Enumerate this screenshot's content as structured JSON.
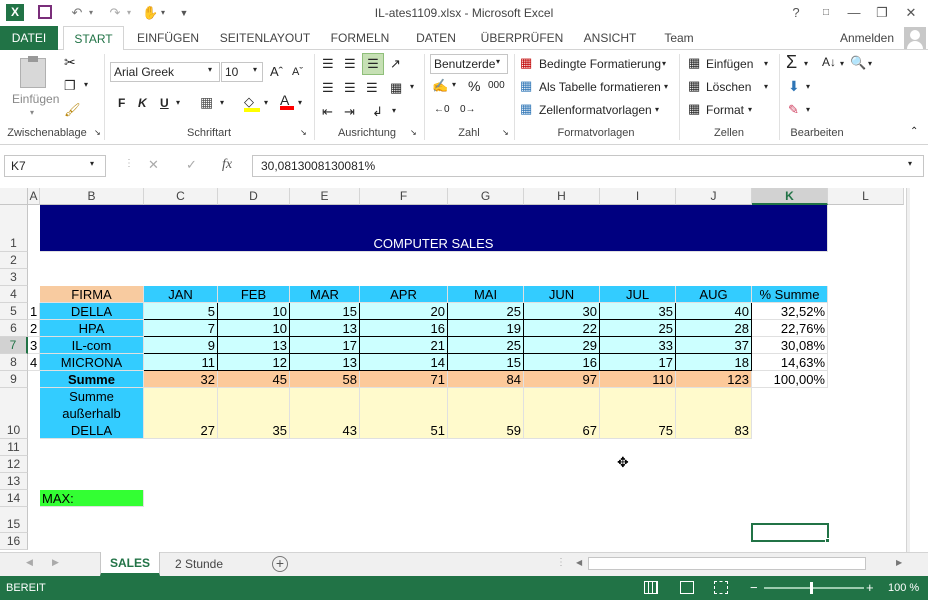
{
  "title": "IL-ates1109.xlsx - Microsoft Excel",
  "window_buttons": {
    "help": "?",
    "restore_ribbon": "□",
    "minimize": "—",
    "maximize": "❐",
    "close": "✕"
  },
  "quick_access": {
    "excel_logo": "X"
  },
  "ribbon_tabs": [
    "DATEI",
    "START",
    "EINFÜGEN",
    "SEITENLAYOUT",
    "FORMELN",
    "DATEN",
    "ÜBERPRÜFEN",
    "ANSICHT",
    "Team"
  ],
  "signin": "Anmelden",
  "ribbon": {
    "clipboard": {
      "paste_label": "Einfügen",
      "group_label": "Zwischenablage"
    },
    "font": {
      "font_name": "Arial Greek",
      "font_size": "10",
      "bold": "F",
      "italic": "K",
      "underline": "U",
      "group_label": "Schriftart"
    },
    "alignment": {
      "group_label": "Ausrichtung"
    },
    "number": {
      "format": "Benutzerde",
      "percent": "%",
      "thousands": "000",
      "group_label": "Zahl"
    },
    "styles": {
      "conditional": "Bedingte Formatierung",
      "as_table": "Als Tabelle formatieren",
      "cell_styles": "Zellenformatvorlagen",
      "group_label": "Formatvorlagen"
    },
    "cells": {
      "insert": "Einfügen",
      "delete": "Löschen",
      "format": "Format",
      "group_label": "Zellen"
    },
    "editing": {
      "group_label": "Bearbeiten"
    }
  },
  "formula_bar": {
    "name_box": "K7",
    "fx": "fx",
    "cancel": "✕",
    "enter": "✓",
    "formula": "30,0813008130081%"
  },
  "columns": [
    "A",
    "B",
    "C",
    "D",
    "E",
    "F",
    "G",
    "H",
    "I",
    "J",
    "K",
    "L"
  ],
  "rows": [
    "1",
    "2",
    "3",
    "4",
    "5",
    "6",
    "7",
    "8",
    "9",
    "10",
    "11",
    "12",
    "13",
    "14",
    "15",
    "16"
  ],
  "sheet": {
    "title_banner": "COMPUTER SALES",
    "header_firma": "FIRMA",
    "months": [
      "JAN",
      "FEB",
      "MAR",
      "APR",
      "MAI",
      "JUN",
      "JUL",
      "AUG"
    ],
    "header_pct": "% Summe",
    "companies": [
      {
        "idx": "1",
        "name": "DELLA",
        "values": [
          "5",
          "10",
          "15",
          "20",
          "25",
          "30",
          "35",
          "40"
        ],
        "pct": "32,52%"
      },
      {
        "idx": "2",
        "name": "HPA",
        "values": [
          "7",
          "10",
          "13",
          "16",
          "19",
          "22",
          "25",
          "28"
        ],
        "pct": "22,76%"
      },
      {
        "idx": "3",
        "name": "IL-com",
        "values": [
          "9",
          "13",
          "17",
          "21",
          "25",
          "29",
          "33",
          "37"
        ],
        "pct": "30,08%"
      },
      {
        "idx": "4",
        "name": "MICRONA",
        "values": [
          "11",
          "12",
          "13",
          "14",
          "15",
          "16",
          "17",
          "18"
        ],
        "pct": "14,63%"
      }
    ],
    "sum_label": "Summe",
    "sum_values": [
      "32",
      "45",
      "58",
      "71",
      "84",
      "97",
      "110",
      "123"
    ],
    "sum_pct": "100,00%",
    "outside_label_1": "Summe",
    "outside_label_2": "außerhalb",
    "outside_label_3": "DELLA",
    "outside_values": [
      "27",
      "35",
      "43",
      "51",
      "59",
      "67",
      "75",
      "83"
    ],
    "max_label": "MAX:"
  },
  "sheet_tabs": [
    "SALES",
    "2 Stunde"
  ],
  "status": {
    "mode": "BEREIT",
    "zoom": "100 %",
    "minus": "−",
    "plus": "+"
  },
  "colors": {
    "excel_green": "#217346",
    "banner": "#000080",
    "header_blue": "#33ccff",
    "firma_orange": "#f8cba0",
    "data_cyan": "#ccffff",
    "sum_orange": "#fcc99a",
    "outside_yellow": "#fffacc",
    "max_green": "#33ff33"
  }
}
